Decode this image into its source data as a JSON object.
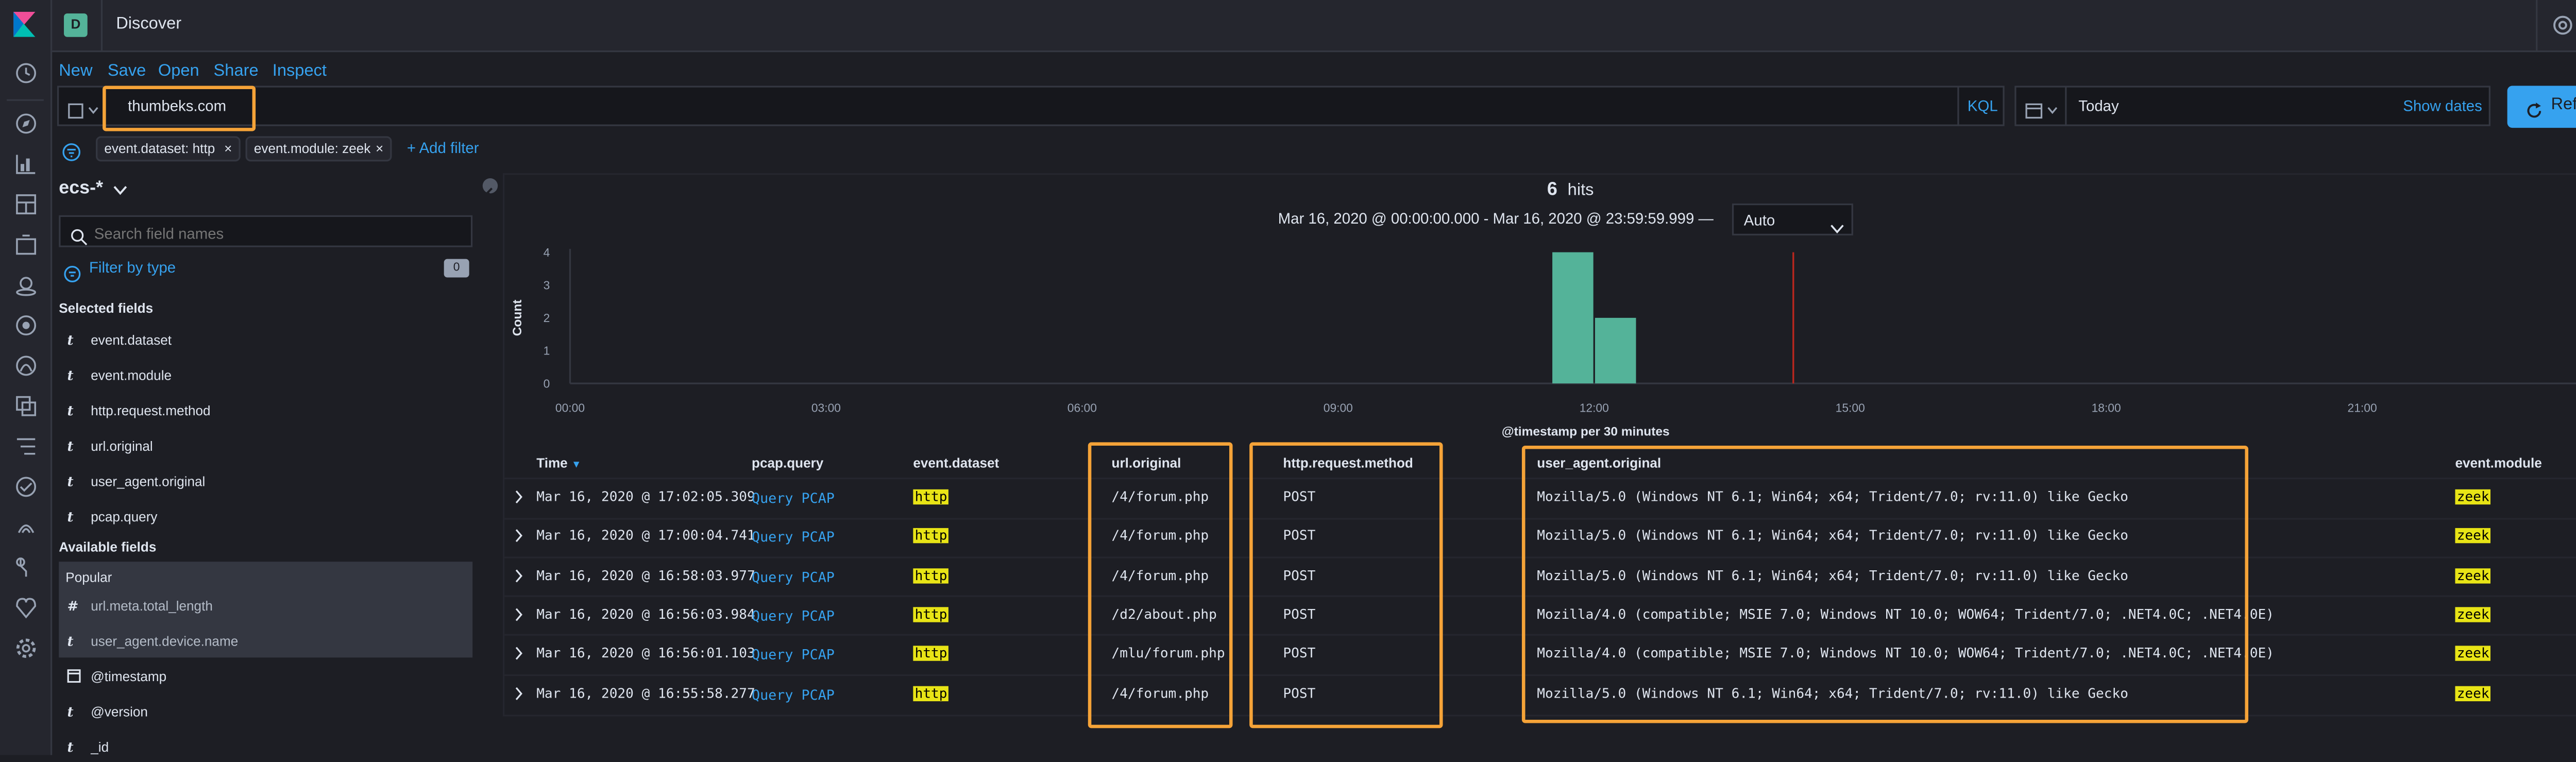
{
  "app": {
    "space_letter": "D",
    "title": "Discover"
  },
  "toolbar": {
    "new": "New",
    "save": "Save",
    "open": "Open",
    "share": "Share",
    "inspect": "Inspect"
  },
  "query": {
    "value": "thumbeks.com",
    "language": "KQL"
  },
  "time": {
    "value": "Today",
    "show_dates": "Show dates",
    "refresh": "Refresh"
  },
  "filters": {
    "items": [
      "event.dataset: http",
      "event.module: zeek"
    ],
    "add_filter": "+ Add filter"
  },
  "sidebar": {
    "index_pattern": "ecs-*",
    "search_placeholder": "Search field names",
    "filter_by_type": "Filter by type",
    "filter_count": "0",
    "selected_title": "Selected fields",
    "selected": [
      {
        "type": "t",
        "name": "event.dataset"
      },
      {
        "type": "t",
        "name": "event.module"
      },
      {
        "type": "t",
        "name": "http.request.method"
      },
      {
        "type": "t",
        "name": "url.original"
      },
      {
        "type": "t",
        "name": "user_agent.original"
      },
      {
        "type": "t",
        "name": "pcap.query"
      }
    ],
    "available_title": "Available fields",
    "popular_title": "Popular",
    "popular": [
      {
        "type": "#",
        "name": "url.meta.total_length"
      },
      {
        "type": "t",
        "name": "user_agent.device.name"
      }
    ],
    "available": [
      {
        "type": "clock",
        "name": "@timestamp"
      },
      {
        "type": "t",
        "name": "@version"
      },
      {
        "type": "t",
        "name": "_id"
      }
    ]
  },
  "hits": {
    "count": "6",
    "label": "hits"
  },
  "date_range": "Mar 16, 2020 @ 00:00:00.000 - Mar 16, 2020 @ 23:59:59.999 —",
  "interval": "Auto",
  "chart_data": {
    "type": "bar",
    "xlabel": "@timestamp per 30 minutes",
    "ylabel": "Count",
    "x_ticks": [
      "00:00",
      "03:00",
      "06:00",
      "09:00",
      "12:00",
      "15:00",
      "18:00",
      "21:00"
    ],
    "y_ticks": [
      "0",
      "1",
      "2",
      "3",
      "4"
    ],
    "ylim": [
      0,
      4
    ],
    "bars": [
      {
        "start": "11:30",
        "end": "12:00",
        "value": 4
      },
      {
        "start": "12:00",
        "end": "12:30",
        "value": 2
      }
    ],
    "current_time_marker": "14:20",
    "bar_color": "#54b399"
  },
  "table": {
    "columns": [
      "Time",
      "pcap.query",
      "event.dataset",
      "url.original",
      "http.request.method",
      "user_agent.original",
      "event.module"
    ],
    "rows": [
      {
        "time": "Mar 16, 2020 @ 17:02:05.309",
        "pcap": "Query PCAP",
        "dataset": "http",
        "url": "/4/forum.php",
        "method": "POST",
        "ua": "Mozilla/5.0 (Windows NT 6.1; Win64; x64; Trident/7.0; rv:11.0) like Gecko",
        "module": "zeek"
      },
      {
        "time": "Mar 16, 2020 @ 17:00:04.741",
        "pcap": "Query PCAP",
        "dataset": "http",
        "url": "/4/forum.php",
        "method": "POST",
        "ua": "Mozilla/5.0 (Windows NT 6.1; Win64; x64; Trident/7.0; rv:11.0) like Gecko",
        "module": "zeek"
      },
      {
        "time": "Mar 16, 2020 @ 16:58:03.977",
        "pcap": "Query PCAP",
        "dataset": "http",
        "url": "/4/forum.php",
        "method": "POST",
        "ua": "Mozilla/5.0 (Windows NT 6.1; Win64; x64; Trident/7.0; rv:11.0) like Gecko",
        "module": "zeek"
      },
      {
        "time": "Mar 16, 2020 @ 16:56:03.984",
        "pcap": "Query PCAP",
        "dataset": "http",
        "url": "/d2/about.php",
        "method": "POST",
        "ua": "Mozilla/4.0 (compatible; MSIE 7.0; Windows NT 10.0; WOW64; Trident/7.0; .NET4.0C; .NET4.0E)",
        "module": "zeek"
      },
      {
        "time": "Mar 16, 2020 @ 16:56:01.103",
        "pcap": "Query PCAP",
        "dataset": "http",
        "url": "/mlu/forum.php",
        "method": "POST",
        "ua": "Mozilla/4.0 (compatible; MSIE 7.0; Windows NT 10.0; WOW64; Trident/7.0; .NET4.0C; .NET4.0E)",
        "module": "zeek"
      },
      {
        "time": "Mar 16, 2020 @ 16:55:58.277",
        "pcap": "Query PCAP",
        "dataset": "http",
        "url": "/4/forum.php",
        "method": "POST",
        "ua": "Mozilla/5.0 (Windows NT 6.1; Win64; x64; Trident/7.0; rv:11.0) like Gecko",
        "module": "zeek"
      }
    ]
  },
  "colors": {
    "accent": "#36a2ef",
    "highlight": "#e8e416",
    "annotation": "#f5a338",
    "bar": "#54b399",
    "marker": "#bd271e"
  },
  "icons": {
    "sidenav": [
      "clock-icon",
      "compass-icon",
      "visualize-icon",
      "dashboard-icon",
      "canvas-icon",
      "maps-icon",
      "ml-icon",
      "metrics-icon",
      "logs-icon",
      "apm-icon",
      "uptime-icon",
      "siem-icon",
      "dev-tools-icon",
      "monitoring-icon",
      "management-icon"
    ]
  }
}
